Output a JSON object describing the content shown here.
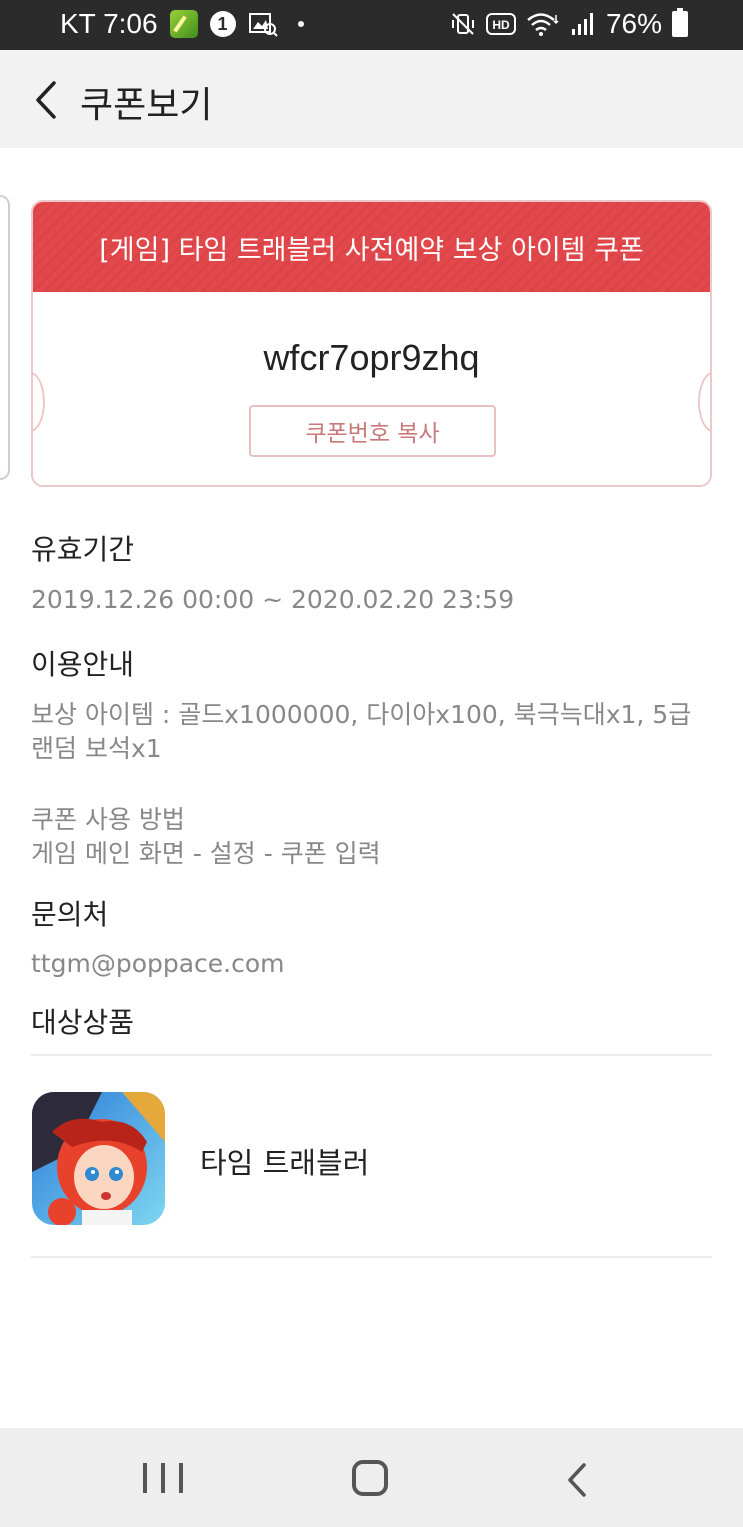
{
  "status_bar": {
    "carrier": "KT",
    "time": "7:06",
    "badge": "1",
    "battery": "76%"
  },
  "header": {
    "title": "쿠폰보기"
  },
  "coupon": {
    "title": "[게임] 타임 트래블러 사전예약 보상 아이템 쿠폰",
    "code": "wfcr7opr9zhq",
    "copy_label": "쿠폰번호 복사",
    "accent_color": "#e1484c"
  },
  "validity": {
    "title": "유효기간",
    "period": "2019.12.26 00:00 ~ 2020.02.20 23:59"
  },
  "usage": {
    "title": "이용안내",
    "reward": "보상 아이템 : 골드x1000000, 다이아x100, 북극늑대x1, 5급 랜덤 보석x1",
    "method_title": "쿠폰 사용 방법",
    "method_text": "게임 메인 화면 - 설정 - 쿠폰 입력"
  },
  "contact": {
    "title": "문의처",
    "email": "ttgm@poppace.com"
  },
  "product": {
    "title": "대상상품",
    "name": "타임 트래블러"
  }
}
